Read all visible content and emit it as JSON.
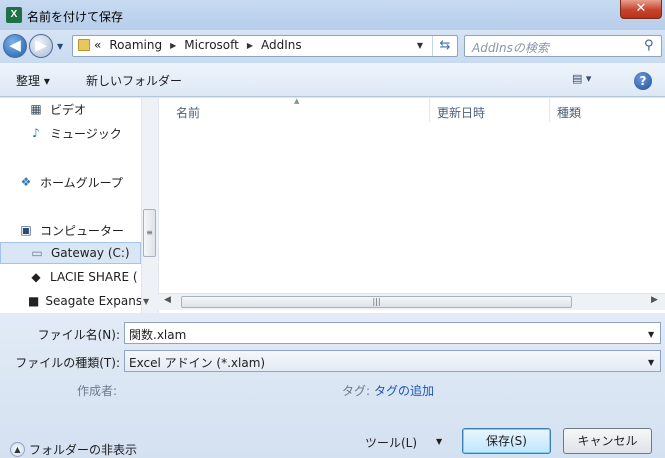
{
  "window": {
    "title": "名前を付けて保存",
    "app_icon": "X",
    "close": "✕"
  },
  "address": {
    "prefix": "«",
    "crumbs": [
      "Roaming",
      "Microsoft",
      "AddIns"
    ]
  },
  "search": {
    "placeholder": "AddInsの検索"
  },
  "toolbar": {
    "organize": "整理 ▾",
    "new_folder": "新しいフォルダー",
    "view": "▤ ▾",
    "help": "?"
  },
  "sidebar": {
    "items": [
      {
        "label": "ビデオ",
        "icon": "video-icon",
        "glyph": "▦"
      },
      {
        "label": "ミュージック",
        "icon": "music-icon",
        "glyph": "♪"
      },
      {
        "label": "ホームグループ",
        "icon": "homegroup-icon",
        "glyph": "❖"
      },
      {
        "label": "コンピューター",
        "icon": "computer-icon",
        "glyph": "▣"
      },
      {
        "label": "Gateway (C:)",
        "icon": "drive-icon",
        "glyph": "▭"
      },
      {
        "label": "LACIE SHARE (",
        "icon": "network-drive-icon",
        "glyph": "◆"
      },
      {
        "label": "Seagate Expans",
        "icon": "external-drive-icon",
        "glyph": "■"
      }
    ]
  },
  "columns": {
    "name": "名前",
    "date": "更新日時",
    "type": "種類"
  },
  "form": {
    "filename_label": "ファイル名(N):",
    "filename_value": "関数.xlam",
    "filetype_label": "ファイルの種類(T):",
    "filetype_value": "Excel アドイン (*.xlam)",
    "author_label": "作成者:",
    "tag_label": "タグ:",
    "tag_link": "タグの追加"
  },
  "footer": {
    "hide_folders": "フォルダーの非表示",
    "tools": "ツール(L)",
    "save": "保存(S)",
    "cancel": "キャンセル"
  },
  "colors": {
    "accent": "#1a56b8",
    "close": "#c7432b",
    "selection": "#d8e6f6"
  }
}
